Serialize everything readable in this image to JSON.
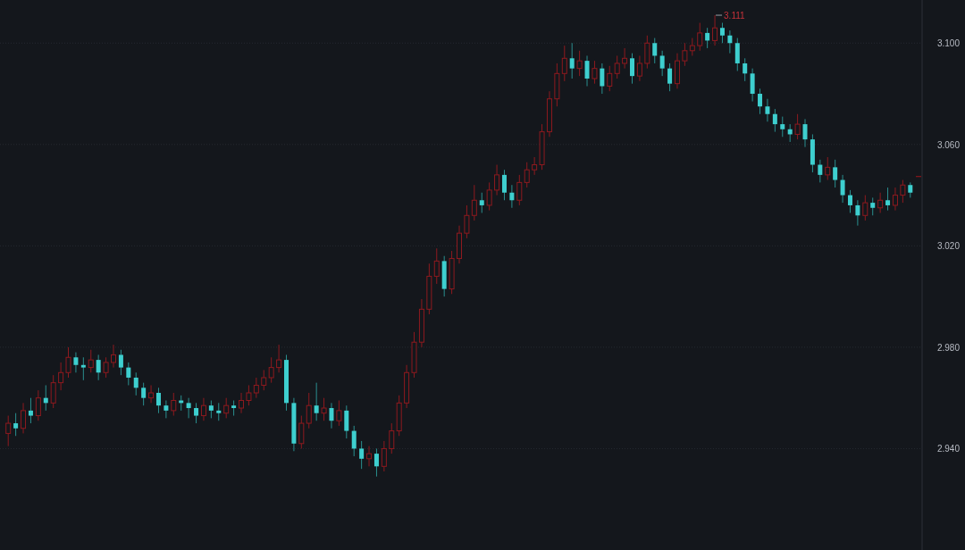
{
  "chart": {
    "chart_data": {
      "type": "candlestick",
      "ylim": [
        2.9,
        3.117
      ],
      "yticks": [
        {
          "value": 3.1,
          "label": "3.100"
        },
        {
          "value": 3.06,
          "label": "3.060"
        },
        {
          "value": 3.02,
          "label": "3.020"
        },
        {
          "value": 2.98,
          "label": "2.980"
        },
        {
          "value": 2.94,
          "label": "2.940"
        }
      ],
      "grid": true,
      "annotations": [
        "3.111"
      ],
      "ohlc": [
        [
          2.946,
          2.953,
          2.941,
          2.95
        ],
        [
          2.95,
          2.954,
          2.945,
          2.948
        ],
        [
          2.948,
          2.958,
          2.946,
          2.955
        ],
        [
          2.955,
          2.96,
          2.95,
          2.953
        ],
        [
          2.953,
          2.963,
          2.951,
          2.96
        ],
        [
          2.96,
          2.965,
          2.955,
          2.958
        ],
        [
          2.958,
          2.969,
          2.956,
          2.966
        ],
        [
          2.966,
          2.974,
          2.963,
          2.97
        ],
        [
          2.97,
          2.98,
          2.968,
          2.976
        ],
        [
          2.976,
          2.978,
          2.97,
          2.973
        ],
        [
          2.973,
          2.976,
          2.967,
          2.972
        ],
        [
          2.972,
          2.979,
          2.97,
          2.975
        ],
        [
          2.975,
          2.977,
          2.967,
          2.97
        ],
        [
          2.97,
          2.976,
          2.968,
          2.974
        ],
        [
          2.974,
          2.981,
          2.972,
          2.977
        ],
        [
          2.977,
          2.979,
          2.969,
          2.972
        ],
        [
          2.972,
          2.974,
          2.965,
          2.968
        ],
        [
          2.968,
          2.97,
          2.961,
          2.964
        ],
        [
          2.964,
          2.966,
          2.957,
          2.96
        ],
        [
          2.96,
          2.965,
          2.958,
          2.962
        ],
        [
          2.962,
          2.964,
          2.954,
          2.957
        ],
        [
          2.957,
          2.959,
          2.952,
          2.955
        ],
        [
          2.955,
          2.962,
          2.953,
          2.959
        ],
        [
          2.959,
          2.961,
          2.955,
          2.958
        ],
        [
          2.958,
          2.96,
          2.952,
          2.956
        ],
        [
          2.956,
          2.958,
          2.95,
          2.953
        ],
        [
          2.953,
          2.96,
          2.951,
          2.957
        ],
        [
          2.957,
          2.959,
          2.952,
          2.955
        ],
        [
          2.955,
          2.958,
          2.951,
          2.954
        ],
        [
          2.954,
          2.96,
          2.952,
          2.957
        ],
        [
          2.957,
          2.959,
          2.953,
          2.956
        ],
        [
          2.956,
          2.962,
          2.954,
          2.959
        ],
        [
          2.959,
          2.965,
          2.957,
          2.962
        ],
        [
          2.962,
          2.968,
          2.96,
          2.965
        ],
        [
          2.965,
          2.971,
          2.963,
          2.968
        ],
        [
          2.968,
          2.976,
          2.966,
          2.972
        ],
        [
          2.972,
          2.981,
          2.97,
          2.975
        ],
        [
          2.975,
          2.977,
          2.955,
          2.958
        ],
        [
          2.958,
          2.96,
          2.939,
          2.942
        ],
        [
          2.942,
          2.953,
          2.94,
          2.95
        ],
        [
          2.95,
          2.962,
          2.948,
          2.957
        ],
        [
          2.957,
          2.966,
          2.951,
          2.954
        ],
        [
          2.954,
          2.96,
          2.951,
          2.956
        ],
        [
          2.956,
          2.958,
          2.948,
          2.951
        ],
        [
          2.951,
          2.959,
          2.949,
          2.955
        ],
        [
          2.955,
          2.957,
          2.944,
          2.947
        ],
        [
          2.947,
          2.949,
          2.937,
          2.94
        ],
        [
          2.94,
          2.943,
          2.932,
          2.936
        ],
        [
          2.936,
          2.941,
          2.933,
          2.938
        ],
        [
          2.938,
          2.94,
          2.929,
          2.933
        ],
        [
          2.933,
          2.943,
          2.931,
          2.94
        ],
        [
          2.94,
          2.95,
          2.938,
          2.947
        ],
        [
          2.947,
          2.961,
          2.945,
          2.958
        ],
        [
          2.958,
          2.973,
          2.956,
          2.97
        ],
        [
          2.97,
          2.986,
          2.968,
          2.982
        ],
        [
          2.982,
          2.999,
          2.98,
          2.995
        ],
        [
          2.995,
          3.013,
          2.993,
          3.008
        ],
        [
          3.008,
          3.019,
          3.005,
          3.014
        ],
        [
          3.014,
          3.016,
          3.0,
          3.003
        ],
        [
          3.003,
          3.018,
          3.001,
          3.015
        ],
        [
          3.015,
          3.028,
          3.013,
          3.025
        ],
        [
          3.025,
          3.036,
          3.023,
          3.032
        ],
        [
          3.032,
          3.044,
          3.03,
          3.038
        ],
        [
          3.038,
          3.041,
          3.033,
          3.036
        ],
        [
          3.036,
          3.045,
          3.034,
          3.042
        ],
        [
          3.042,
          3.052,
          3.04,
          3.048
        ],
        [
          3.048,
          3.05,
          3.038,
          3.041
        ],
        [
          3.041,
          3.044,
          3.035,
          3.038
        ],
        [
          3.038,
          3.048,
          3.036,
          3.045
        ],
        [
          3.045,
          3.053,
          3.043,
          3.05
        ],
        [
          3.05,
          3.055,
          3.048,
          3.052
        ],
        [
          3.052,
          3.068,
          3.05,
          3.065
        ],
        [
          3.065,
          3.081,
          3.063,
          3.078
        ],
        [
          3.078,
          3.092,
          3.075,
          3.088
        ],
        [
          3.088,
          3.099,
          3.085,
          3.094
        ],
        [
          3.094,
          3.1,
          3.086,
          3.09
        ],
        [
          3.09,
          3.097,
          3.087,
          3.093
        ],
        [
          3.093,
          3.095,
          3.083,
          3.086
        ],
        [
          3.086,
          3.093,
          3.084,
          3.09
        ],
        [
          3.09,
          3.092,
          3.08,
          3.083
        ],
        [
          3.083,
          3.091,
          3.081,
          3.088
        ],
        [
          3.088,
          3.095,
          3.086,
          3.092
        ],
        [
          3.092,
          3.098,
          3.09,
          3.094
        ],
        [
          3.094,
          3.096,
          3.084,
          3.087
        ],
        [
          3.087,
          3.095,
          3.085,
          3.092
        ],
        [
          3.092,
          3.103,
          3.09,
          3.1
        ],
        [
          3.1,
          3.102,
          3.092,
          3.095
        ],
        [
          3.095,
          3.097,
          3.087,
          3.09
        ],
        [
          3.09,
          3.092,
          3.081,
          3.084
        ],
        [
          3.084,
          3.096,
          3.082,
          3.093
        ],
        [
          3.093,
          3.1,
          3.091,
          3.097
        ],
        [
          3.097,
          3.102,
          3.095,
          3.099
        ],
        [
          3.099,
          3.108,
          3.097,
          3.104
        ],
        [
          3.104,
          3.106,
          3.098,
          3.101
        ],
        [
          3.101,
          3.111,
          3.099,
          3.106
        ],
        [
          3.106,
          3.108,
          3.1,
          3.103
        ],
        [
          3.103,
          3.105,
          3.096,
          3.1
        ],
        [
          3.1,
          3.102,
          3.089,
          3.092
        ],
        [
          3.092,
          3.094,
          3.085,
          3.088
        ],
        [
          3.088,
          3.09,
          3.077,
          3.08
        ],
        [
          3.08,
          3.082,
          3.072,
          3.075
        ],
        [
          3.075,
          3.078,
          3.069,
          3.072
        ],
        [
          3.072,
          3.074,
          3.065,
          3.068
        ],
        [
          3.068,
          3.071,
          3.063,
          3.066
        ],
        [
          3.066,
          3.068,
          3.061,
          3.064
        ],
        [
          3.064,
          3.072,
          3.062,
          3.068
        ],
        [
          3.068,
          3.07,
          3.059,
          3.062
        ],
        [
          3.062,
          3.064,
          3.049,
          3.052
        ],
        [
          3.052,
          3.054,
          3.045,
          3.048
        ],
        [
          3.048,
          3.055,
          3.046,
          3.051
        ],
        [
          3.051,
          3.054,
          3.043,
          3.046
        ],
        [
          3.046,
          3.048,
          3.037,
          3.04
        ],
        [
          3.04,
          3.042,
          3.033,
          3.036
        ],
        [
          3.036,
          3.038,
          3.028,
          3.032
        ],
        [
          3.032,
          3.04,
          3.03,
          3.037
        ],
        [
          3.037,
          3.039,
          3.032,
          3.035
        ],
        [
          3.035,
          3.041,
          3.033,
          3.038
        ],
        [
          3.038,
          3.043,
          3.034,
          3.036
        ],
        [
          3.036,
          3.043,
          3.034,
          3.04
        ],
        [
          3.04,
          3.046,
          3.037,
          3.044
        ],
        [
          3.044,
          3.045,
          3.039,
          3.041
        ]
      ]
    }
  }
}
